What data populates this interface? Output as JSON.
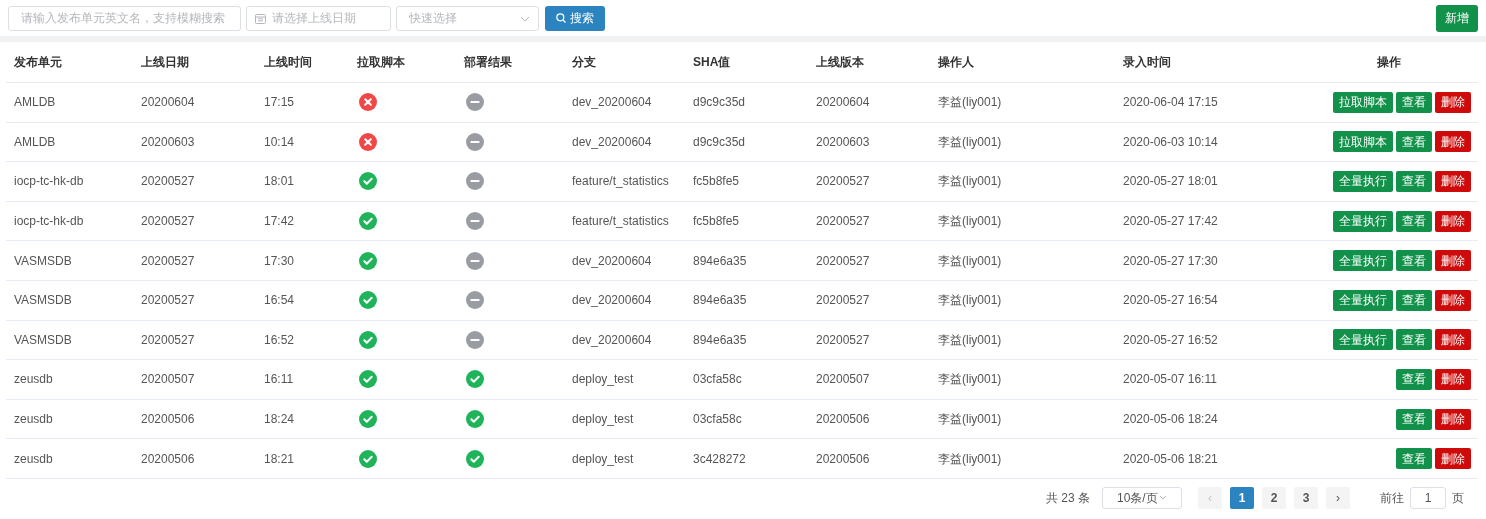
{
  "toolbar": {
    "name_search": {
      "placeholder": "请输入发布单元英文名，支持模糊搜索"
    },
    "date_picker": {
      "placeholder": "请选择上线日期"
    },
    "quick_select": {
      "placeholder": "快速选择"
    },
    "search_button": "搜索",
    "add_button": "新增"
  },
  "table": {
    "columns": [
      "发布单元",
      "上线日期",
      "上线时间",
      "拉取脚本",
      "部署结果",
      "分支",
      "SHA值",
      "上线版本",
      "操作人",
      "录入时间",
      "操作"
    ],
    "rows": [
      {
        "unit": "AMLDB",
        "date": "20200604",
        "time": "17:15",
        "pull": {
          "kind": "fail"
        },
        "deploy": {
          "kind": "none"
        },
        "branch": "dev_20200604",
        "sha": "d9c9c35d",
        "version": "20200604",
        "operator": "李益(liy001)",
        "created": "2020-06-04 17:15",
        "actions": [
          {
            "label": "拉取脚本",
            "kind": "primary"
          },
          {
            "label": "查看",
            "kind": "primary"
          },
          {
            "label": "删除",
            "kind": "danger"
          }
        ]
      },
      {
        "unit": "AMLDB",
        "date": "20200603",
        "time": "10:14",
        "pull": {
          "kind": "fail"
        },
        "deploy": {
          "kind": "none"
        },
        "branch": "dev_20200604",
        "sha": "d9c9c35d",
        "version": "20200603",
        "operator": "李益(liy001)",
        "created": "2020-06-03 10:14",
        "actions": [
          {
            "label": "拉取脚本",
            "kind": "primary"
          },
          {
            "label": "查看",
            "kind": "primary"
          },
          {
            "label": "删除",
            "kind": "danger"
          }
        ]
      },
      {
        "unit": "iocp-tc-hk-db",
        "date": "20200527",
        "time": "18:01",
        "pull": {
          "kind": "success"
        },
        "deploy": {
          "kind": "none"
        },
        "branch": "feature/t_statistics",
        "sha": "fc5b8fe5",
        "version": "20200527",
        "operator": "李益(liy001)",
        "created": "2020-05-27 18:01",
        "actions": [
          {
            "label": "全量执行",
            "kind": "primary"
          },
          {
            "label": "查看",
            "kind": "primary"
          },
          {
            "label": "删除",
            "kind": "danger"
          }
        ]
      },
      {
        "unit": "iocp-tc-hk-db",
        "date": "20200527",
        "time": "17:42",
        "pull": {
          "kind": "success"
        },
        "deploy": {
          "kind": "none"
        },
        "branch": "feature/t_statistics",
        "sha": "fc5b8fe5",
        "version": "20200527",
        "operator": "李益(liy001)",
        "created": "2020-05-27 17:42",
        "actions": [
          {
            "label": "全量执行",
            "kind": "primary"
          },
          {
            "label": "查看",
            "kind": "primary"
          },
          {
            "label": "删除",
            "kind": "danger"
          }
        ]
      },
      {
        "unit": "VASMSDB",
        "date": "20200527",
        "time": "17:30",
        "pull": {
          "kind": "success"
        },
        "deploy": {
          "kind": "none"
        },
        "branch": "dev_20200604",
        "sha": "894e6a35",
        "version": "20200527",
        "operator": "李益(liy001)",
        "created": "2020-05-27 17:30",
        "actions": [
          {
            "label": "全量执行",
            "kind": "primary"
          },
          {
            "label": "查看",
            "kind": "primary"
          },
          {
            "label": "删除",
            "kind": "danger"
          }
        ]
      },
      {
        "unit": "VASMSDB",
        "date": "20200527",
        "time": "16:54",
        "pull": {
          "kind": "success"
        },
        "deploy": {
          "kind": "none"
        },
        "branch": "dev_20200604",
        "sha": "894e6a35",
        "version": "20200527",
        "operator": "李益(liy001)",
        "created": "2020-05-27 16:54",
        "actions": [
          {
            "label": "全量执行",
            "kind": "primary"
          },
          {
            "label": "查看",
            "kind": "primary"
          },
          {
            "label": "删除",
            "kind": "danger"
          }
        ]
      },
      {
        "unit": "VASMSDB",
        "date": "20200527",
        "time": "16:52",
        "pull": {
          "kind": "success"
        },
        "deploy": {
          "kind": "none"
        },
        "branch": "dev_20200604",
        "sha": "894e6a35",
        "version": "20200527",
        "operator": "李益(liy001)",
        "created": "2020-05-27 16:52",
        "actions": [
          {
            "label": "全量执行",
            "kind": "primary"
          },
          {
            "label": "查看",
            "kind": "primary"
          },
          {
            "label": "删除",
            "kind": "danger"
          }
        ]
      },
      {
        "unit": "zeusdb",
        "date": "20200507",
        "time": "16:11",
        "pull": {
          "kind": "success"
        },
        "deploy": {
          "kind": "success"
        },
        "branch": "deploy_test",
        "sha": "03cfa58c",
        "version": "20200507",
        "operator": "李益(liy001)",
        "created": "2020-05-07 16:11",
        "actions": [
          {
            "label": "查看",
            "kind": "primary"
          },
          {
            "label": "删除",
            "kind": "danger"
          }
        ]
      },
      {
        "unit": "zeusdb",
        "date": "20200506",
        "time": "18:24",
        "pull": {
          "kind": "success"
        },
        "deploy": {
          "kind": "success"
        },
        "branch": "deploy_test",
        "sha": "03cfa58c",
        "version": "20200506",
        "operator": "李益(liy001)",
        "created": "2020-05-06 18:24",
        "actions": [
          {
            "label": "查看",
            "kind": "primary"
          },
          {
            "label": "删除",
            "kind": "danger"
          }
        ]
      },
      {
        "unit": "zeusdb",
        "date": "20200506",
        "time": "18:21",
        "pull": {
          "kind": "success"
        },
        "deploy": {
          "kind": "success"
        },
        "branch": "deploy_test",
        "sha": "3c428272",
        "version": "20200506",
        "operator": "李益(liy001)",
        "created": "2020-05-06 18:21",
        "actions": [
          {
            "label": "查看",
            "kind": "primary"
          },
          {
            "label": "删除",
            "kind": "danger"
          }
        ]
      }
    ]
  },
  "pagination": {
    "total": "共 23 条",
    "page_size": "10条/页",
    "prev": "‹",
    "pages": [
      {
        "label": "1",
        "selected": true
      },
      {
        "label": "2",
        "selected": false
      },
      {
        "label": "3",
        "selected": false
      }
    ],
    "next": "›",
    "goto_label": "前往",
    "goto_value": "1",
    "goto_suffix": "页"
  }
}
